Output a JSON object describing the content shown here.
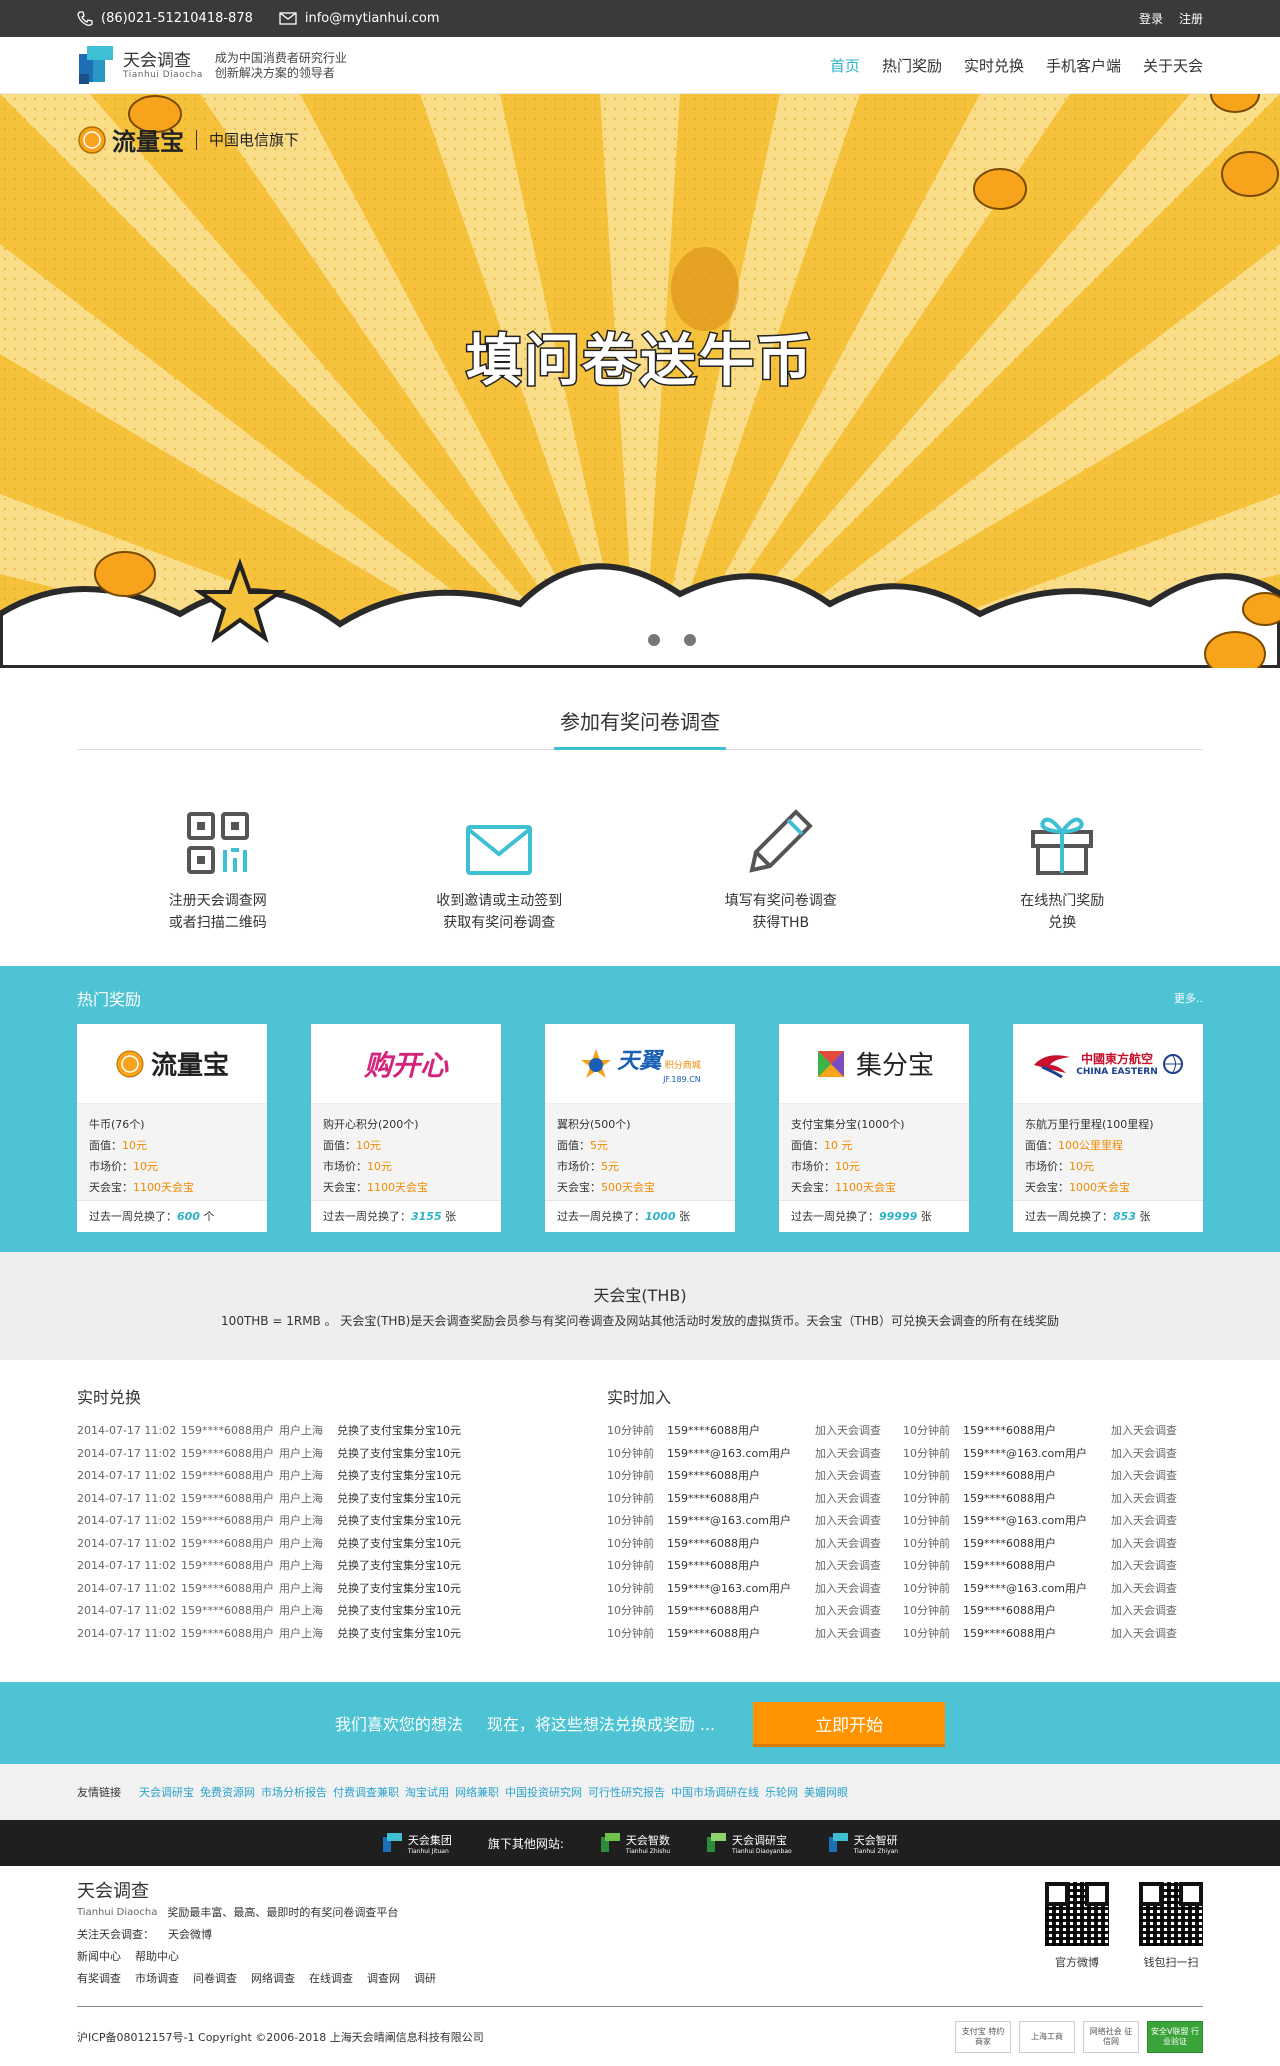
{
  "topbar": {
    "phone": "(86)021-51210418-878",
    "email": "info@mytianhui.com",
    "login": "登录",
    "register": "注册"
  },
  "header": {
    "logo_cn": "天会调查",
    "logo_en": "Tianhui  Diaocha",
    "slogan_1": "成为中国消费者研究行业",
    "slogan_2": "创新解决方案的领导者",
    "nav": [
      "首页",
      "热门奖励",
      "实时兑换",
      "手机客户端",
      "关于天会"
    ]
  },
  "banner": {
    "brand_name": "流量宝",
    "brand_sub": "中国电信旗下",
    "headline": "填问卷送牛币"
  },
  "steps": {
    "title": "参加有奖问卷调查",
    "items": [
      {
        "line1": "注册天会调查网",
        "line2": "或者扫描二维码"
      },
      {
        "line1": "收到邀请或主动签到",
        "line2": "获取有奖问卷调查"
      },
      {
        "line1": "填写有奖问卷调查",
        "line2": "获得THB"
      },
      {
        "line1": "在线热门奖励",
        "line2": "兑换"
      }
    ]
  },
  "hot": {
    "title": "热门奖励",
    "more": "更多..",
    "label_face": "面值：",
    "label_market": "市场价：",
    "label_thb": "天会宝：",
    "label_week": "过去一周兑换了：",
    "cards": [
      {
        "brand": "流量宝",
        "name": "牛币(76个)",
        "face": "10元",
        "market": "10元",
        "thb": "1100天会宝",
        "week": "600",
        "unit": "个"
      },
      {
        "brand": "购开心",
        "name": "购开心积分(200个)",
        "face": "10元",
        "market": "10元",
        "thb": "1100天会宝",
        "week": "3155",
        "unit": "张"
      },
      {
        "brand": "天翼",
        "brand_sub": "积分商城",
        "brand_url": "JF.189.CN",
        "name": "翼积分(500个)",
        "face": "5元",
        "market": "5元",
        "thb": "500天会宝",
        "week": "1000",
        "unit": "张"
      },
      {
        "brand": "集分宝",
        "name": "支付宝集分宝(1000个)",
        "face": "10 元",
        "market": "10元",
        "thb": "1100天会宝",
        "week": "99999",
        "unit": "张"
      },
      {
        "brand": "中國東方航空",
        "brand_en": "CHINA EASTERN",
        "name": "东航万里行里程(100里程)",
        "face": "100公里里程",
        "market": "10元",
        "thb": "1000天会宝",
        "week": "853",
        "unit": "张"
      }
    ]
  },
  "thb": {
    "title": "天会宝(THB)",
    "desc": "100THB = 1RMB 。 天会宝(THB)是天会调查奖励会员参与有奖问卷调查及网站其他活动时发放的虚拟货币。天会宝（THB）可兑换天会调查的所有在线奖励"
  },
  "realtime": {
    "exchange_title": "实时兑换",
    "join_title": "实时加入",
    "exchange_rows": [
      {
        "time": "2014-07-17 11:02",
        "user": "159****6088用户",
        "city": "用户上海",
        "action": "兑换了支付宝集分宝10元"
      },
      {
        "time": "2014-07-17 11:02",
        "user": "159****6088用户",
        "city": "用户上海",
        "action": "兑换了支付宝集分宝10元"
      },
      {
        "time": "2014-07-17 11:02",
        "user": "159****6088用户",
        "city": "用户上海",
        "action": "兑换了支付宝集分宝10元"
      },
      {
        "time": "2014-07-17 11:02",
        "user": "159****6088用户",
        "city": "用户上海",
        "action": "兑换了支付宝集分宝10元"
      },
      {
        "time": "2014-07-17 11:02",
        "user": "159****6088用户",
        "city": "用户上海",
        "action": "兑换了支付宝集分宝10元"
      },
      {
        "time": "2014-07-17 11:02",
        "user": "159****6088用户",
        "city": "用户上海",
        "action": "兑换了支付宝集分宝10元"
      },
      {
        "time": "2014-07-17 11:02",
        "user": "159****6088用户",
        "city": "用户上海",
        "action": "兑换了支付宝集分宝10元"
      },
      {
        "time": "2014-07-17 11:02",
        "user": "159****6088用户",
        "city": "用户上海",
        "action": "兑换了支付宝集分宝10元"
      },
      {
        "time": "2014-07-17 11:02",
        "user": "159****6088用户",
        "city": "用户上海",
        "action": "兑换了支付宝集分宝10元"
      },
      {
        "time": "2014-07-17 11:02",
        "user": "159****6088用户",
        "city": "用户上海",
        "action": "兑换了支付宝集分宝10元"
      }
    ],
    "join_rows": [
      {
        "t1": "10分钟前",
        "u1": "159****6088用户",
        "a1": "加入天会调查",
        "t2": "10分钟前",
        "u2": "159****6088用户",
        "a2": "加入天会调查"
      },
      {
        "t1": "10分钟前",
        "u1": "159****@163.com用户",
        "a1": "加入天会调查",
        "t2": "10分钟前",
        "u2": "159****@163.com用户",
        "a2": "加入天会调查"
      },
      {
        "t1": "10分钟前",
        "u1": "159****6088用户",
        "a1": "加入天会调查",
        "t2": "10分钟前",
        "u2": "159****6088用户",
        "a2": "加入天会调查"
      },
      {
        "t1": "10分钟前",
        "u1": "159****6088用户",
        "a1": "加入天会调查",
        "t2": "10分钟前",
        "u2": "159****6088用户",
        "a2": "加入天会调查"
      },
      {
        "t1": "10分钟前",
        "u1": "159****@163.com用户",
        "a1": "加入天会调查",
        "t2": "10分钟前",
        "u2": "159****@163.com用户",
        "a2": "加入天会调查"
      },
      {
        "t1": "10分钟前",
        "u1": "159****6088用户",
        "a1": "加入天会调查",
        "t2": "10分钟前",
        "u2": "159****6088用户",
        "a2": "加入天会调查"
      },
      {
        "t1": "10分钟前",
        "u1": "159****6088用户",
        "a1": "加入天会调查",
        "t2": "10分钟前",
        "u2": "159****6088用户",
        "a2": "加入天会调查"
      },
      {
        "t1": "10分钟前",
        "u1": "159****@163.com用户",
        "a1": "加入天会调查",
        "t2": "10分钟前",
        "u2": "159****@163.com用户",
        "a2": "加入天会调查"
      },
      {
        "t1": "10分钟前",
        "u1": "159****6088用户",
        "a1": "加入天会调查",
        "t2": "10分钟前",
        "u2": "159****6088用户",
        "a2": "加入天会调查"
      },
      {
        "t1": "10分钟前",
        "u1": "159****6088用户",
        "a1": "加入天会调查",
        "t2": "10分钟前",
        "u2": "159****6088用户",
        "a2": "加入天会调查"
      }
    ]
  },
  "cta": {
    "text1": "我们喜欢您的想法",
    "text2": "现在，将这些想法兑换成奖励 ...",
    "button": "立即开始"
  },
  "links": {
    "label": "友情链接",
    "items": [
      "天会调研宝",
      "免费资源网",
      "市场分析报告",
      "付费调查兼职",
      "淘宝试用",
      "网络兼职",
      "中国投资研究网",
      "可行性研究报告",
      "中国市场调研在线",
      "乐轮网",
      "美媚网眼"
    ]
  },
  "others": {
    "label": "旗下其他网站:",
    "sites": [
      {
        "cn": "天会集团",
        "en": "Tianhui Jituan"
      },
      {
        "cn": "天会智数",
        "en": "Tianhui Zhishu"
      },
      {
        "cn": "天会调研宝",
        "en": "Tianhui Diaoyanbao"
      },
      {
        "cn": "天会智研",
        "en": "Tianhui Zhiyan"
      }
    ]
  },
  "footer": {
    "name": "天会调查",
    "en": "Tianhui  Diaocha",
    "tagline": "奖励最丰富、最高、最即时的有奖问卷调查平台",
    "follow": "关注天会调查：",
    "weibo": "天会微博",
    "row2": [
      "新闻中心",
      "帮助中心"
    ],
    "row3": [
      "有奖调查",
      "市场调查",
      "问卷调查",
      "网络调查",
      "在线调查",
      "调查网",
      "调研"
    ],
    "qr1": "官方微博",
    "qr2": "钱包扫一扫",
    "icp": "沪ICP备08012157号-1  Copyright ©2006-2018 上海天会晴阐信息科技有限公司",
    "badges": [
      "支付宝 特约商家",
      "上海工商",
      "网络社会 征信网",
      "安全V联盟 行业验证"
    ]
  },
  "colors": {
    "accent": "#4ec3d3",
    "nav_active": "#2bb3c8",
    "banner_yellow": "#f6c23b",
    "cta_orange": "#ff9400",
    "value_orange": "#f08a00"
  }
}
